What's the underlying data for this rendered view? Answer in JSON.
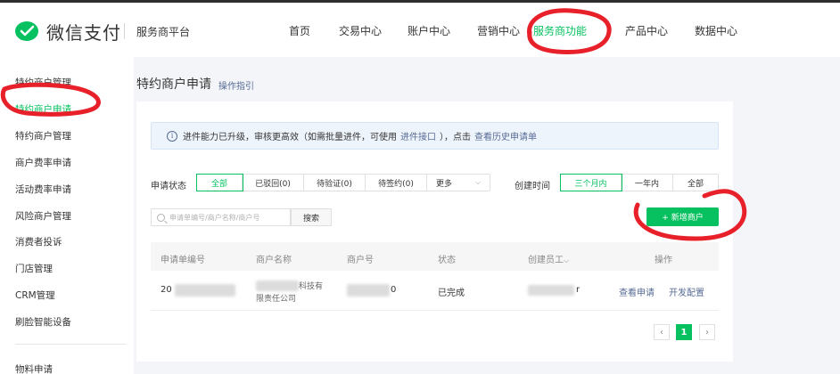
{
  "header": {
    "logo_text": "微信支付",
    "platform": "服务商平台",
    "nav": [
      {
        "label": "首页"
      },
      {
        "label": "交易中心"
      },
      {
        "label": "账户中心"
      },
      {
        "label": "营销中心"
      },
      {
        "label": "服务商功能",
        "active": true
      },
      {
        "label": "产品中心"
      },
      {
        "label": "数据中心"
      }
    ]
  },
  "sidebar": {
    "items": [
      {
        "label": "特约商户管理"
      },
      {
        "label": "特约商户申请",
        "active": true
      },
      {
        "label": "特约商户管理"
      },
      {
        "label": "商户费率申请"
      },
      {
        "label": "活动费率申请"
      },
      {
        "label": "风险商户管理"
      },
      {
        "label": "消费者投诉"
      },
      {
        "label": "门店管理"
      },
      {
        "label": "CRM管理"
      },
      {
        "label": "刷脸智能设备"
      },
      {
        "label": "物料申请"
      }
    ]
  },
  "main": {
    "title": "特约商户申请",
    "guide_link": "操作指引",
    "notice": {
      "text_before": "进件能力已升级，审核更高效（如需批量进件，可使用",
      "link1": "进件接口",
      "text_middle": "），点击",
      "link2": "查看历史申请单"
    },
    "filters": {
      "status_label": "申请状态",
      "status_options": [
        "全部",
        "已驳回(0)",
        "待验证(0)",
        "待签约(0)",
        "更多"
      ],
      "status_selected": "全部",
      "time_label": "创建时间",
      "time_options": [
        "三个月内",
        "一年内",
        "全部"
      ],
      "time_selected": "三个月内"
    },
    "search": {
      "placeholder": "申请单编号/商户名称/商户号",
      "value": "",
      "button_label": "搜索"
    },
    "add_button_label": "+ 新增商户",
    "table": {
      "columns": [
        "申请单编号",
        "商户名称",
        "商户号",
        "状态",
        "创建员工",
        "操作"
      ],
      "rows": [
        {
          "application_id": "20",
          "merchant_name_line1": "科技有",
          "merchant_name_line2": "限责任公司",
          "merchant_no": "0",
          "status": "已完成",
          "creator": "r",
          "actions": [
            "查看申请",
            "开发配置"
          ]
        }
      ]
    },
    "pagination": {
      "current_page": "1",
      "prev_symbol": "‹",
      "next_symbol": "›"
    }
  },
  "colors": {
    "brand_green": "#07c160",
    "link_blue": "#576b95",
    "annotation_red": "#e8202a"
  }
}
